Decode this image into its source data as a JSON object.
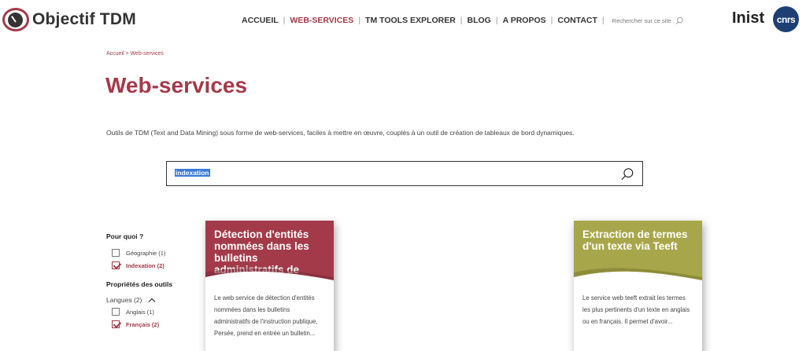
{
  "header": {
    "logo_text": "Objectif TDM",
    "nav": [
      {
        "label": "ACCUEIL"
      },
      {
        "label": "WEB-SERVICES"
      },
      {
        "label": "TM TOOLS EXPLORER"
      },
      {
        "label": "BLOG"
      },
      {
        "label": "A PROPOS"
      },
      {
        "label": "CONTACT"
      }
    ],
    "active_nav": "WEB-SERVICES",
    "search_placeholder": "Rechercher sur ce site",
    "partner_logo_text": "Inist",
    "cnrs_logo_text": "cnrs"
  },
  "breadcrumb": {
    "home": "Accueil",
    "separator": ">",
    "current": "Web-services"
  },
  "page": {
    "title": "Web-services",
    "intro": "Outils de TDM (Text and Data Mining) sous forme de web-services, faciles à mettre en œuvre, couplés à un outil de création de tableaux de bord dynamiques."
  },
  "search": {
    "value": "indexation",
    "icon": "search-icon"
  },
  "filters": {
    "pour_quoi": {
      "heading": "Pour quoi ?",
      "options": [
        {
          "label": "Géographie (1)",
          "checked": false
        },
        {
          "label": "Indexation (2)",
          "checked": true
        }
      ]
    },
    "proprietes": {
      "heading": "Propriétés des outils",
      "langues_label": "Langues (2)",
      "options": [
        {
          "label": "Anglais (1)",
          "checked": false
        },
        {
          "label": "Français (2)",
          "checked": true
        }
      ]
    }
  },
  "cards": [
    {
      "title": "Détection d'entités nommées dans les bulletins administratifs de l'instruction",
      "description": "Le web service de détection d'entités nommées dans les bulletins administratifs de l'instruction publique, Persée, prend en entrée un bulletin...",
      "color": "#a33a4a"
    },
    {
      "title": "Extraction de termes d'un texte via Teeft",
      "description": "Le service web teeft extrait les termes les plus pertinents d'un texte en anglais ou en français. Il permet d'avoir...",
      "color": "#a8a64a"
    }
  ],
  "colors": {
    "brand": "#a33a4a",
    "card_olive": "#a8a64a",
    "cnrs_blue": "#1d3f73"
  }
}
